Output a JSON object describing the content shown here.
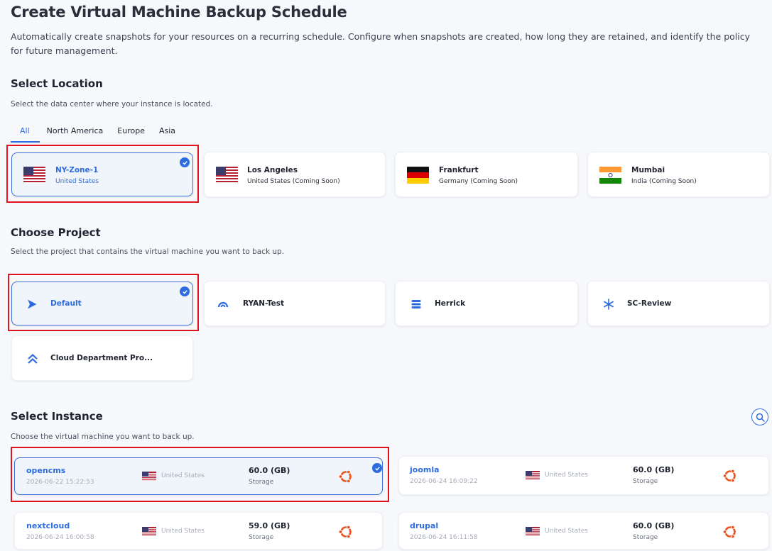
{
  "header": {
    "title": "Create Virtual Machine Backup Schedule",
    "description": "Automatically create snapshots for your resources on a recurring schedule. Configure when snapshots are created, how long they are retained, and identify the policy for future management."
  },
  "location": {
    "title": "Select Location",
    "description": "Select the data center where your instance is located.",
    "tabs": [
      "All",
      "North America",
      "Europe",
      "Asia"
    ],
    "active_tab": "All",
    "items": [
      {
        "name": "NY-Zone-1",
        "sub": "United States",
        "flag": "us-flag",
        "selected": true
      },
      {
        "name": "Los Angeles",
        "sub": "United States (Coming Soon)",
        "flag": "us-flag",
        "selected": false
      },
      {
        "name": "Frankfurt",
        "sub": "Germany (Coming Soon)",
        "flag": "germany-flag",
        "selected": false
      },
      {
        "name": "Mumbai",
        "sub": "India (Coming Soon)",
        "flag": "india-flag",
        "selected": false
      }
    ]
  },
  "project": {
    "title": "Choose Project",
    "description": "Select the project that contains the virtual machine you want to back up.",
    "items": [
      {
        "name": "Default",
        "icon": "send-arrow-icon",
        "selected": true
      },
      {
        "name": "RYAN-Test",
        "icon": "arc-gauge-icon",
        "selected": false
      },
      {
        "name": "Herrick",
        "icon": "database-stack-icon",
        "selected": false
      },
      {
        "name": "SC-Review",
        "icon": "snowflake-icon",
        "selected": false
      },
      {
        "name": "Cloud Department Pro...",
        "icon": "double-chevron-up-icon",
        "selected": false
      }
    ]
  },
  "instance": {
    "title": "Select Instance",
    "description": "Choose the virtual machine you want to back up.",
    "search_icon": "search-icon",
    "size_label": "Storage",
    "items": [
      {
        "name": "opencms",
        "date": "2026-06-22 15:22:53",
        "region": "United States",
        "size": "60.0 (GB)",
        "os": "ubuntu-icon",
        "selected": true
      },
      {
        "name": "joomla",
        "date": "2026-06-24 16:09:22",
        "region": "United States",
        "size": "60.0 (GB)",
        "os": "ubuntu-icon",
        "selected": false
      },
      {
        "name": "nextcloud",
        "date": "2026-06-24 16:00:58",
        "region": "United States",
        "size": "59.0 (GB)",
        "os": "ubuntu-icon",
        "selected": false
      },
      {
        "name": "drupal",
        "date": "2026-06-24 16:11:58",
        "region": "United States",
        "size": "60.0 (GB)",
        "os": "ubuntu-icon",
        "selected": false
      }
    ]
  },
  "colors": {
    "accent": "#2d6cdf",
    "highlight_outline": "#e0141e",
    "background": "#f6f8fb"
  }
}
